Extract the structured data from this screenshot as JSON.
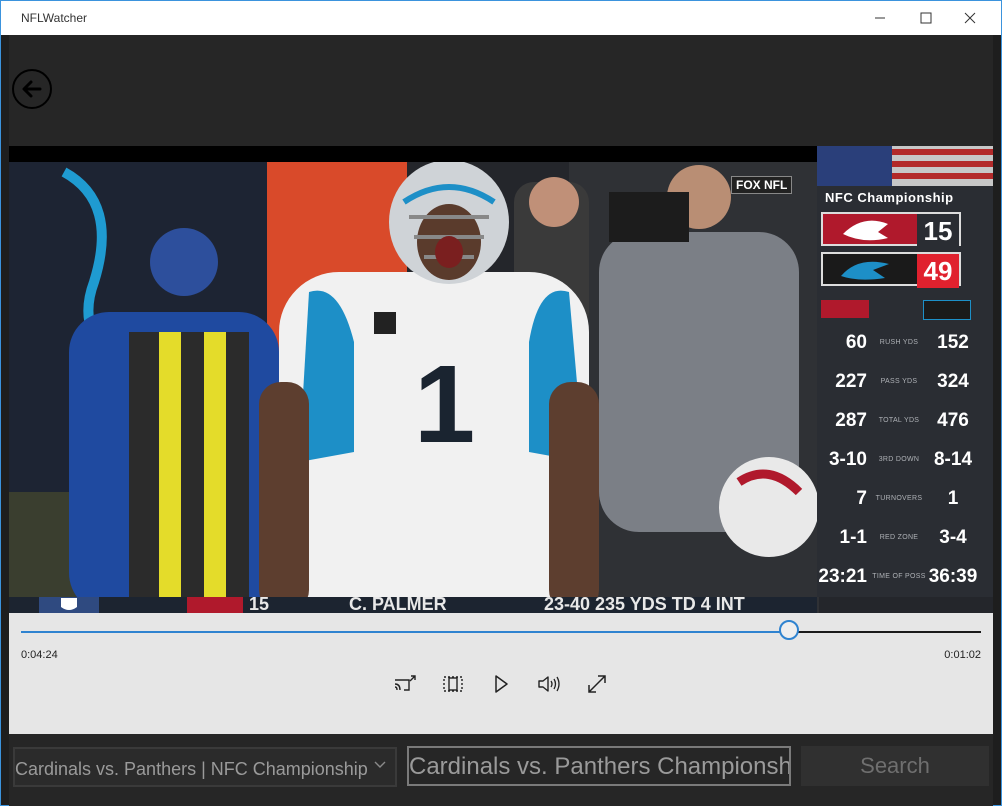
{
  "window": {
    "title": "NFLWatcher",
    "minimize": "—",
    "maximize": "☐",
    "close": "✕"
  },
  "scoreboard": {
    "title": "NFC Championship",
    "network": "FOX NFL",
    "teams": [
      {
        "name": "Cardinals",
        "score": "15",
        "color": "#b0192c"
      },
      {
        "name": "Panthers",
        "score": "49",
        "color": "#1d8fc7"
      }
    ],
    "stats": [
      {
        "left": "60",
        "label": "RUSH YDS",
        "right": "152"
      },
      {
        "left": "227",
        "label": "PASS YDS",
        "right": "324"
      },
      {
        "left": "287",
        "label": "TOTAL YDS",
        "right": "476"
      },
      {
        "left": "3-10",
        "label": "3RD DOWN",
        "right": "8-14"
      },
      {
        "left": "7",
        "label": "TURNOVERS",
        "right": "1"
      },
      {
        "left": "1-1",
        "label": "RED ZONE",
        "right": "3-4"
      },
      {
        "left": "23:21",
        "label": "TIME OF POSS",
        "right": "36:39"
      }
    ],
    "jersey_number": "1",
    "ticker": {
      "score": "15",
      "name": "C. PALMER",
      "line": "23-40  235 YDS  TD  4 INT"
    }
  },
  "player": {
    "progress": 0.8,
    "elapsed": "0:04:24",
    "remaining": "0:01:02",
    "buttons": [
      "cast-icon",
      "aspect-ratio-icon",
      "play-icon",
      "volume-icon",
      "fullscreen-icon"
    ]
  },
  "bottom": {
    "game_select": "Cardinals vs. Panthers | NFC Championship",
    "search_value": "Cardinals vs. Panthers Championship",
    "search_label": "Search"
  },
  "colors": {
    "accent": "#2f83d0",
    "home_red": "#e0212e",
    "chrome": "#262626"
  }
}
